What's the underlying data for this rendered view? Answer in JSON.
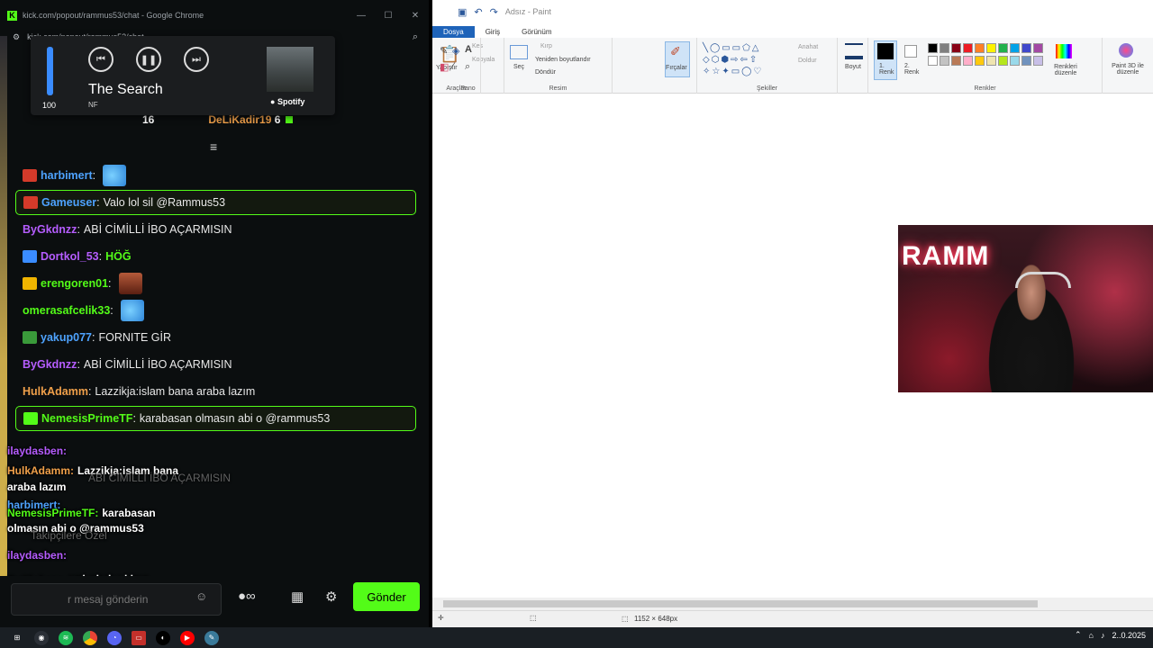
{
  "chrome": {
    "title": "kick.com/popout/rammus53/chat - Google Chrome",
    "url": "kick.com/popout/rammus53/chat"
  },
  "media": {
    "volume": "100",
    "volume_level": 1.0,
    "track": "The Search",
    "artist": "NF",
    "source": "Spotify"
  },
  "leaderboard": {
    "left_value": "16",
    "right_name": "DeLiKadir19",
    "right_value": "6"
  },
  "chat_messages": [
    {
      "user": "harbimert",
      "user_color": "#4ea3ff",
      "text": "",
      "emote": "emote-blue",
      "badge": "#d43a2a"
    },
    {
      "user": "Gameuser",
      "user_color": "#4ea3ff",
      "text": "Valo lol sil @Rammus53",
      "highlight": true,
      "badge": "#d43a2a"
    },
    {
      "user": "ByGkdnzz",
      "user_color": "#b65dff",
      "text": "ABİ CİMİLLİ İBO AÇARMISIN"
    },
    {
      "user": "Dortkol_53",
      "user_color": "#b65dff",
      "text": "HÖĞ",
      "text_green": true,
      "badge": "#3a8cff"
    },
    {
      "user": "erengoren01",
      "user_color": "#53fc18",
      "text": "",
      "emote": "emote-face",
      "badge": "#f0b400"
    },
    {
      "user": "omerasafcelik33",
      "user_color": "#53fc18",
      "text": "",
      "emote": "emote-blue"
    },
    {
      "user": "yakup077",
      "user_color": "#4ea3ff",
      "text": "FORNITE GİR",
      "badge": "#3a9a3a"
    },
    {
      "user": "ByGkdnzz",
      "user_color": "#b65dff",
      "text": "ABİ CİMİLLİ İBO AÇARMISIN"
    },
    {
      "user": "HulkAdamm",
      "user_color": "#f0a04a",
      "text": "Lazzikja:islam bana araba lazım"
    },
    {
      "user": "NemesisPrimeTF",
      "user_color": "#53fc18",
      "text": "karabasan olmasın abi o @rammus53",
      "highlight": true,
      "badge": "#53fc18"
    }
  ],
  "overlay_lines": [
    {
      "user": "ilaydasben:",
      "text": ""
    },
    {
      "user": "HulkAdamm:",
      "text": "Lazzikja:islam bana"
    },
    {
      "user": "",
      "text": "araba lazım"
    },
    {
      "user": "harbimert:",
      "text": ""
    },
    {
      "user": "NemesisPrimeTF:",
      "text": "karabasan"
    },
    {
      "user": "",
      "text": "olmasın abi o @rammus53"
    },
    {
      "user": "ilaydasben:",
      "text": ""
    },
    {
      "user": "ByGkdnzz:",
      "text": "ABİ CİMİLLİ İBO"
    },
    {
      "user": "",
      "text": "AÇARMISIN"
    },
    {
      "user": "harbimert:",
      "text": ""
    }
  ],
  "ghost_text": {
    "faded_line": "ABİ CİMİLLİ İBO AÇARMISIN",
    "followers": "Takipçilere Özel"
  },
  "input": {
    "placeholder": "r mesaj gönderin",
    "send_label": "Gönder"
  },
  "paint": {
    "title": "Adsız - Paint",
    "tabs": [
      "Dosya",
      "Giriş",
      "Görünüm"
    ],
    "groups": {
      "pano": "Pano",
      "resim": "Resim",
      "araclar": "Araçlar",
      "sekiller": "Şekiller",
      "renkler": "Renkler"
    },
    "buttons": {
      "paste": "Yapıştır",
      "cut": "Kes",
      "copy": "Kopyala",
      "select": "Seç",
      "crop": "Kırp",
      "resize": "Yeniden boyutlandır",
      "rotate": "Döndür",
      "brushes": "Fırçalar",
      "outline": "Anahat",
      "fill": "Doldur",
      "size": "Boyut",
      "color1": "1. Renk",
      "color2": "2. Renk",
      "edit_colors": "Renkleri düzenle",
      "paint3d": "Paint 3D ile düzenle"
    },
    "palette": [
      "#000000",
      "#7f7f7f",
      "#880015",
      "#ed1c24",
      "#ff7f27",
      "#fff200",
      "#22b14c",
      "#00a2e8",
      "#3f48cc",
      "#a349a4",
      "#ffffff",
      "#c3c3c3",
      "#b97a57",
      "#ffaec9",
      "#ffc90e",
      "#efe4b0",
      "#b5e61d",
      "#99d9ea",
      "#7092be",
      "#c8bfe7"
    ],
    "status_size": "1152 × 648px"
  },
  "webcam": {
    "neon_text": "RAMM"
  },
  "taskbar": {
    "date": "2..0.2025"
  }
}
